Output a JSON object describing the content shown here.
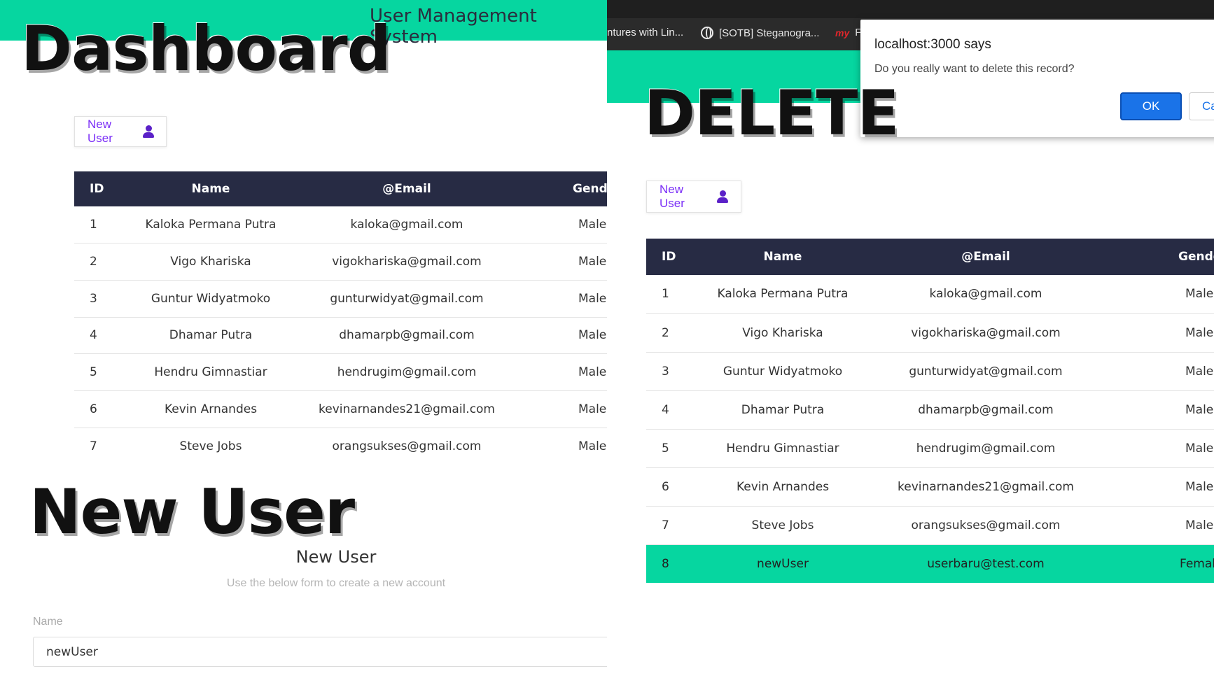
{
  "app": {
    "title": "User Management System"
  },
  "labels": {
    "dashboard": "Dashboard",
    "new_user": "New User",
    "delete": "DELETE"
  },
  "new_user_button": {
    "label": "New User",
    "icon": "user-icon"
  },
  "table": {
    "headers": {
      "id": "ID",
      "name": "Name",
      "email": "@Email",
      "gender": "Gender"
    },
    "rows": [
      {
        "id": "1",
        "name": "Kaloka Permana Putra",
        "email": "kaloka@gmail.com",
        "gender": "Male"
      },
      {
        "id": "2",
        "name": "Vigo Khariska",
        "email": "vigokhariska@gmail.com",
        "gender": "Male"
      },
      {
        "id": "3",
        "name": "Guntur Widyatmoko",
        "email": "gunturwidyat@gmail.com",
        "gender": "Male"
      },
      {
        "id": "4",
        "name": "Dhamar Putra",
        "email": "dhamarpb@gmail.com",
        "gender": "Male"
      },
      {
        "id": "5",
        "name": "Hendru Gimnastiar",
        "email": "hendrugim@gmail.com",
        "gender": "Male"
      },
      {
        "id": "6",
        "name": "Kevin Arnandes",
        "email": "kevinarnandes21@gmail.com",
        "gender": "Male"
      },
      {
        "id": "7",
        "name": "Steve Jobs",
        "email": "orangsukses@gmail.com",
        "gender": "Male"
      },
      {
        "id": "8",
        "name": "newUser",
        "email": "userbaru@test.com",
        "gender": "Female"
      }
    ]
  },
  "form": {
    "title": "New User",
    "subtitle": "Use the below form to create a new account",
    "name_label": "Name",
    "name_value": "newUser"
  },
  "browser": {
    "tabs": [
      {
        "label": "ntures with Lin...",
        "icon": ""
      },
      {
        "label": "[SOTB] Steganogra...",
        "icon": "globe-icon"
      },
      {
        "label": "F",
        "icon": "my-icon"
      }
    ]
  },
  "dialog": {
    "title": "localhost:3000 says",
    "message": "Do you really want to delete this record?",
    "ok_label": "OK",
    "cancel_label": "Ca"
  },
  "colors": {
    "accent": "#06d6a0",
    "table_header": "#272b44",
    "button_text": "#7b2ff7",
    "dialog_ok": "#1a73e8"
  }
}
